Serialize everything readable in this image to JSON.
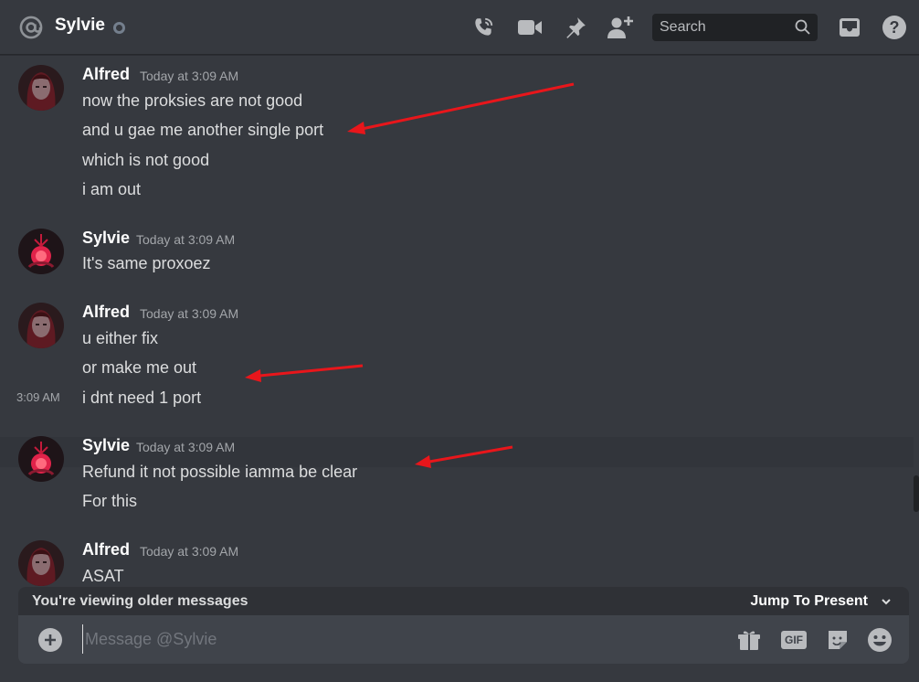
{
  "header": {
    "channel_name": "Sylvie",
    "search_placeholder": "Search",
    "icons": [
      "at-icon",
      "status-dot",
      "call-icon",
      "video-icon",
      "pin-icon",
      "add-friend-icon",
      "search-icon",
      "inbox-icon",
      "help-icon"
    ]
  },
  "messages": [
    {
      "author": "Alfred",
      "timestamp": "Today at 3:09 AM",
      "lines": [
        "now the proksies are not good",
        "and u gae me another single port",
        "which is not good",
        "i am out"
      ]
    },
    {
      "author": "Sylvie",
      "timestamp": "Today at 3:09 AM",
      "lines": [
        "It's same proxoez"
      ]
    },
    {
      "author": "Alfred",
      "timestamp": "Today at 3:09 AM",
      "lines": [
        "u either fix",
        "or make me out",
        "i dnt need 1 port"
      ],
      "hover_timestamp": "3:09 AM"
    },
    {
      "author": "Sylvie",
      "timestamp": "Today at 3:09 AM",
      "lines": [
        "Refund it not possible iamma be clear",
        "For this"
      ]
    },
    {
      "author": "Alfred",
      "timestamp": "Today at 3:09 AM",
      "lines": [
        "ASAT"
      ]
    }
  ],
  "older_bar": {
    "text": "You're viewing older messages",
    "jump_label": "Jump To Present"
  },
  "composer": {
    "placeholder": "Message @Sylvie",
    "gif_label": "GIF"
  },
  "colors": {
    "background": "#36393f",
    "header_text": "#ffffff",
    "text": "#dcddde",
    "muted": "#a3a6aa",
    "arrow": "#e8161b",
    "composer": "#40444b"
  }
}
